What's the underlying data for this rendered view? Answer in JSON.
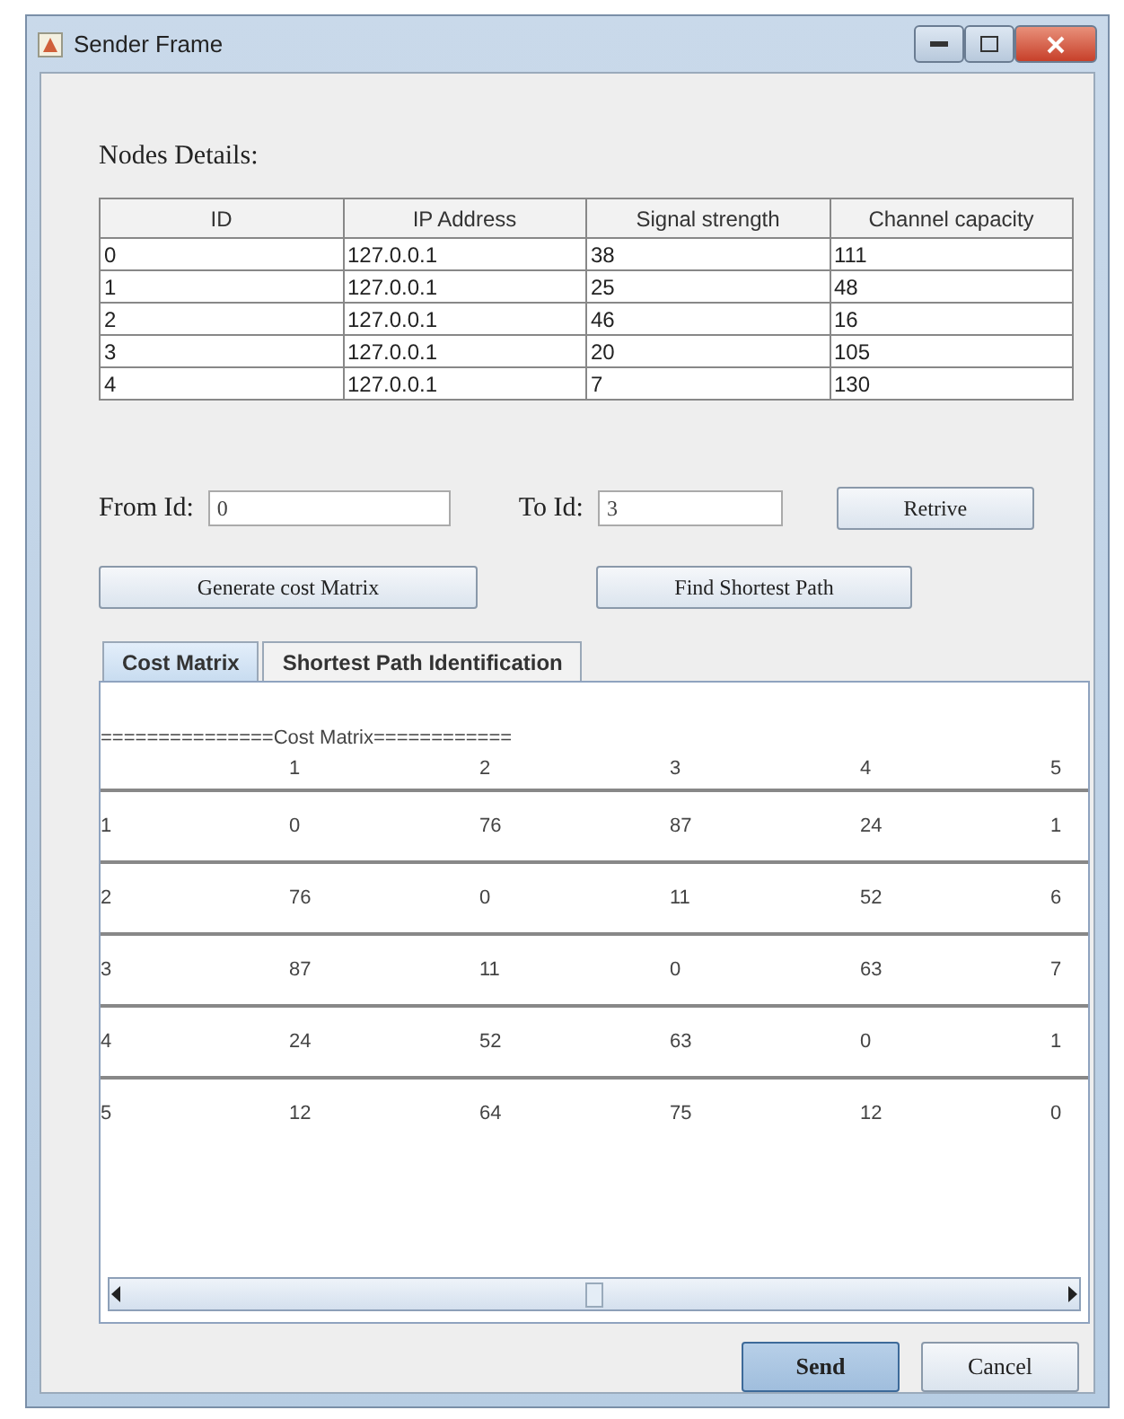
{
  "window": {
    "title": "Sender Frame"
  },
  "nodes_label": "Nodes Details:",
  "nodes_table": {
    "columns": [
      "ID",
      "IP Address",
      "Signal strength",
      "Channel capacity"
    ],
    "rows": [
      [
        "0",
        "127.0.0.1",
        "38",
        "111"
      ],
      [
        "1",
        "127.0.0.1",
        "25",
        "48"
      ],
      [
        "2",
        "127.0.0.1",
        "46",
        "16"
      ],
      [
        "3",
        "127.0.0.1",
        "20",
        "105"
      ],
      [
        "4",
        "127.0.0.1",
        "7",
        "130"
      ]
    ]
  },
  "from_id": {
    "label": "From Id:",
    "value": "0"
  },
  "to_id": {
    "label": "To Id:",
    "value": "3"
  },
  "retrieve_button": "Retrive",
  "generate_button": "Generate cost Matrix",
  "shortest_button": "Find Shortest Path",
  "tabs": [
    {
      "label": "Cost Matrix",
      "selected": true
    },
    {
      "label": "Shortest Path Identification",
      "selected": false
    }
  ],
  "cost_matrix": {
    "title": "===============Cost Matrix============",
    "header": [
      "1",
      "2",
      "3",
      "4",
      "5"
    ],
    "rows": [
      [
        "1",
        "0",
        "76",
        "87",
        "24",
        "1"
      ],
      [
        "2",
        "76",
        "0",
        "11",
        "52",
        "6"
      ],
      [
        "3",
        "87",
        "11",
        "0",
        "63",
        "7"
      ],
      [
        "4",
        "24",
        "52",
        "63",
        "0",
        "1"
      ],
      [
        "5",
        "12",
        "64",
        "75",
        "12",
        "0"
      ]
    ]
  },
  "buttons": [
    {
      "label": "Send",
      "kind": "default"
    },
    {
      "label": "Cancel",
      "kind": "normal"
    }
  ]
}
